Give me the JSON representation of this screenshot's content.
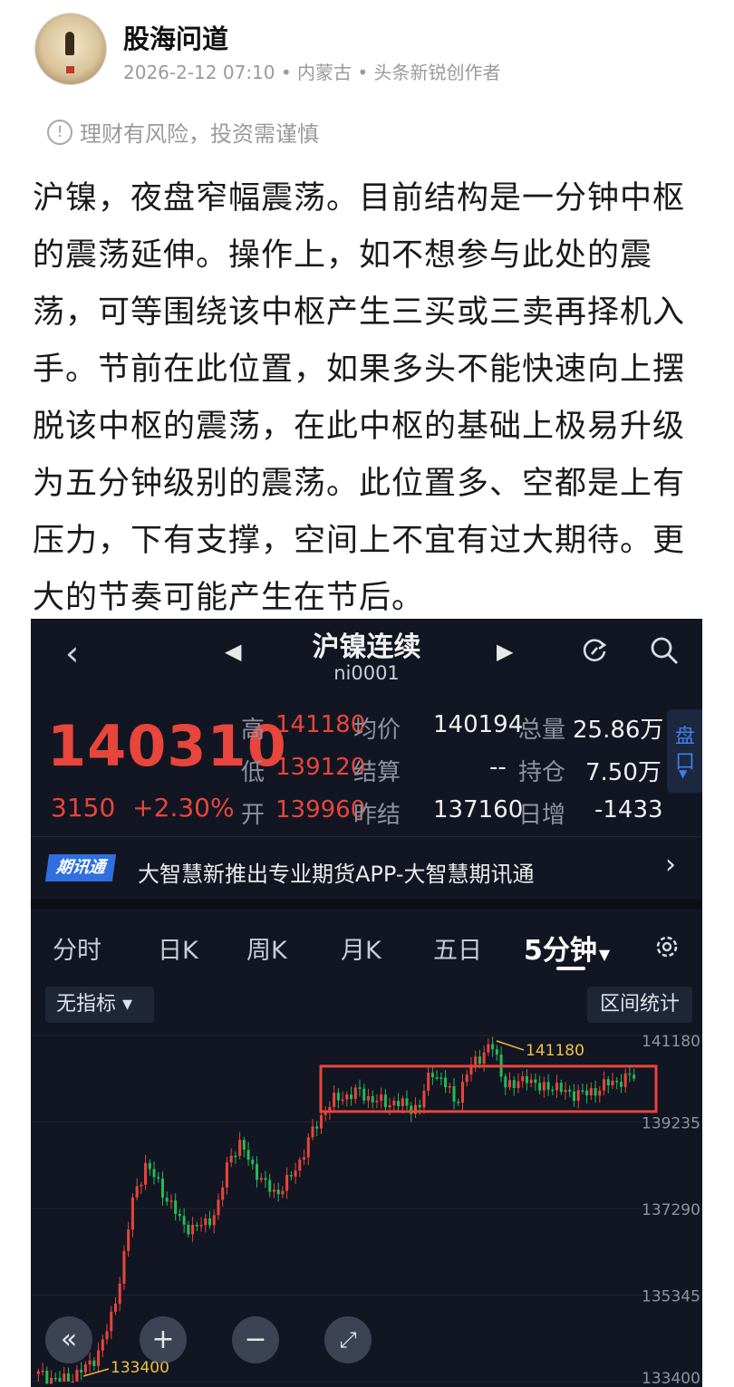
{
  "post": {
    "author": "股海问道",
    "meta": "2026-2-12 07:10 • 内蒙古 • 头条新锐创作者",
    "risk_notice": "理财有风险，投资需谨慎",
    "paragraph": "沪镍，夜盘窄幅震荡。目前结构是一分钟中枢的震荡延伸。操作上，如不想参与此处的震荡，可等围绕该中枢产生三买或三卖再择机入手。节前在此位置，如果多头不能快速向上摆脱该中枢的震荡，在此中枢的基础上极易升级为五分钟级别的震荡。此位置多、空都是上有压力，下有支撑，空间上不宜有过大期待。更大的节奏可能产生在节后。"
  },
  "app": {
    "title": "沪镍连续",
    "code": "ni0001",
    "price": "140310",
    "change": "3150",
    "change_pct": "+2.30%",
    "quotes": {
      "high_label": "高",
      "high": "141180",
      "low_label": "低",
      "low": "139120",
      "open_label": "开",
      "open": "139960",
      "avg_label": "均价",
      "avg": "140194",
      "settle_label": "结算",
      "settle": "--",
      "prev_settle_label": "昨结",
      "prev_settle": "137160",
      "volume_label": "总量",
      "volume": "25.86万",
      "oi_label": "持仓",
      "oi": "7.50万",
      "daily_chg_label": "日增",
      "daily_chg": "-1433"
    },
    "pan_label_1": "盘",
    "pan_label_2": "口",
    "ad": {
      "badge": "期讯通",
      "text": "大智慧新推出专业期货APP-大智慧期讯通"
    },
    "tabs": [
      "分时",
      "日K",
      "周K",
      "月K",
      "五日",
      "5分钟"
    ],
    "indicator_button": "无指标 ▾",
    "range_button": "区间统计",
    "colors": {
      "up": "#e8453c",
      "down": "#27b858",
      "box": "#e8453c",
      "bg": "#121622",
      "accent": "#3f7fe5"
    }
  },
  "chart_data": {
    "type": "candlestick",
    "yticks": [
      "141180",
      "139235",
      "137290",
      "135345",
      "133400"
    ],
    "ylim": [
      133400,
      141180
    ],
    "high_marker": "141180",
    "low_marker": "133400",
    "consolidation_box": {
      "top": 140490,
      "bottom": 139470
    },
    "close_path": [
      133550,
      133500,
      133400,
      133550,
      133700,
      134050,
      134700,
      135900,
      137600,
      138250,
      137900,
      137400,
      137000,
      136800,
      137000,
      137200,
      138500,
      138700,
      138250,
      137800,
      137650,
      137900,
      138400,
      139000,
      139500,
      139750,
      139850,
      139900,
      139750,
      139650,
      139700,
      139550,
      139600,
      140400,
      140150,
      139650,
      140350,
      140700,
      141000,
      140200,
      140000,
      140300,
      139950,
      140100,
      139900,
      139900,
      139850,
      140000,
      140100,
      140200,
      140250
    ]
  }
}
